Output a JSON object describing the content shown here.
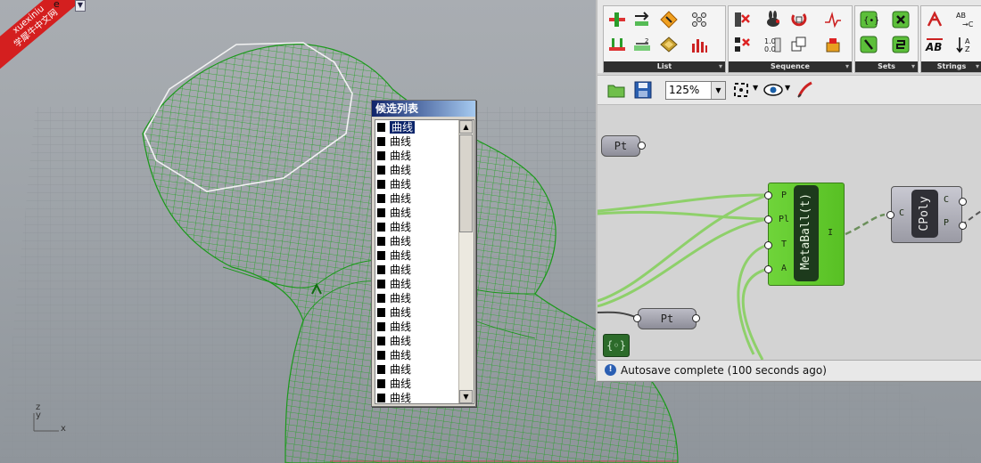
{
  "watermark": {
    "line1": "xuexiniu",
    "line2": "学犀牛中文网"
  },
  "viewport": {
    "title": "e",
    "axis_x": "x",
    "axis_y": "y",
    "axis_z": "z"
  },
  "listbox": {
    "title": "候选列表",
    "items": [
      "曲线",
      "曲线",
      "曲线",
      "曲线",
      "曲线",
      "曲线",
      "曲线",
      "曲线",
      "曲线",
      "曲线",
      "曲线",
      "曲线",
      "曲线",
      "曲线",
      "曲线",
      "曲线",
      "曲线",
      "曲线",
      "曲线",
      "曲线"
    ],
    "selected_index": 0,
    "scroll_up": "▲",
    "scroll_down": "▼"
  },
  "ribbon": {
    "groups": [
      {
        "label": "List"
      },
      {
        "label": "Sequence"
      },
      {
        "label": "Sets"
      },
      {
        "label": "Strings"
      }
    ],
    "strings_icon_text_1": "AB\n→C",
    "strings_icon_text_2": "AB"
  },
  "toolbar": {
    "zoom_value": "125%"
  },
  "canvas": {
    "pt_top_label": "Pt",
    "pt_bottom_label": "Pt",
    "metaball": {
      "title": "MetaBall(t)",
      "inputs": [
        "P",
        "Pl",
        "T",
        "A"
      ],
      "output": "I"
    },
    "cpoly": {
      "title": "CPoly",
      "input": "C",
      "outputs": [
        "C",
        "P"
      ]
    },
    "cluster_icon": "{◦}"
  },
  "status": {
    "text": "Autosave complete (100 seconds ago)"
  },
  "colors": {
    "mesh_green": "#1fa31f",
    "gh_component_green": "#64cc30",
    "list_selection": "#0a246a"
  }
}
